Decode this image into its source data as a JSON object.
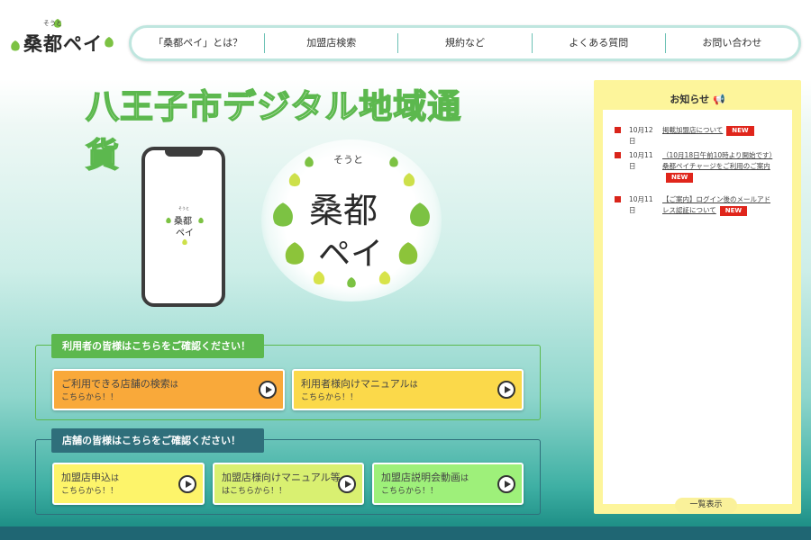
{
  "logo": {
    "ruby": "そうと",
    "name": "桑都ペイ"
  },
  "nav": {
    "items": [
      {
        "label": "「桑都ペイ」とは？"
      },
      {
        "label": "加盟店検索"
      },
      {
        "label": "規約など"
      },
      {
        "label": "よくある質問"
      },
      {
        "label": "お問い合わせ"
      }
    ]
  },
  "hero": {
    "title": "八王子市デジタル地域通貨",
    "logo_ruby": "そうと",
    "logo_line1": "桑都",
    "logo_line2": "ペイ"
  },
  "users_section": {
    "label": "利用者の皆様はこちらをご確認ください！",
    "buttons": [
      {
        "main": "ご利用できる店舗の検索",
        "suffix": "は",
        "sub": "こちらから！！",
        "color": "#f9a93a"
      },
      {
        "main": "利用者様向けマニュアル",
        "suffix": "は",
        "sub": "こちらから！！",
        "color": "#fbd94a"
      }
    ]
  },
  "stores_section": {
    "label": "店舗の皆様はこちらをご確認ください！",
    "buttons": [
      {
        "main": "加盟店申込",
        "suffix": "は",
        "sub": "こちらから！！",
        "color": "#fdf46a"
      },
      {
        "main": "加盟店様向けマニュアル等",
        "suffix": "",
        "sub": "はこちらから！！",
        "color": "#d9f071"
      },
      {
        "main": "加盟店説明会動画",
        "suffix": "は",
        "sub": "こちらから！！",
        "color": "#9ef07a"
      }
    ]
  },
  "news": {
    "title": "お知らせ 📢",
    "items": [
      {
        "date": "10月12日",
        "text": "掲載加盟店について",
        "badge": "NEW"
      },
      {
        "date": "10月11日",
        "text": "（10月18日午前10時より開始です）桑都ペイチャージをご利用のご案内",
        "badge": "NEW"
      },
      {
        "date": "10月11日",
        "text": "【ご案内】ログイン後のメールアドレス認証について",
        "badge": "NEW"
      }
    ],
    "more_label": "一覧表示"
  },
  "colors": {
    "accent_green": "#5cb84e",
    "store_teal": "#2f6f7b",
    "news_yellow": "#fdf59b",
    "badge_red": "#e0251b"
  }
}
